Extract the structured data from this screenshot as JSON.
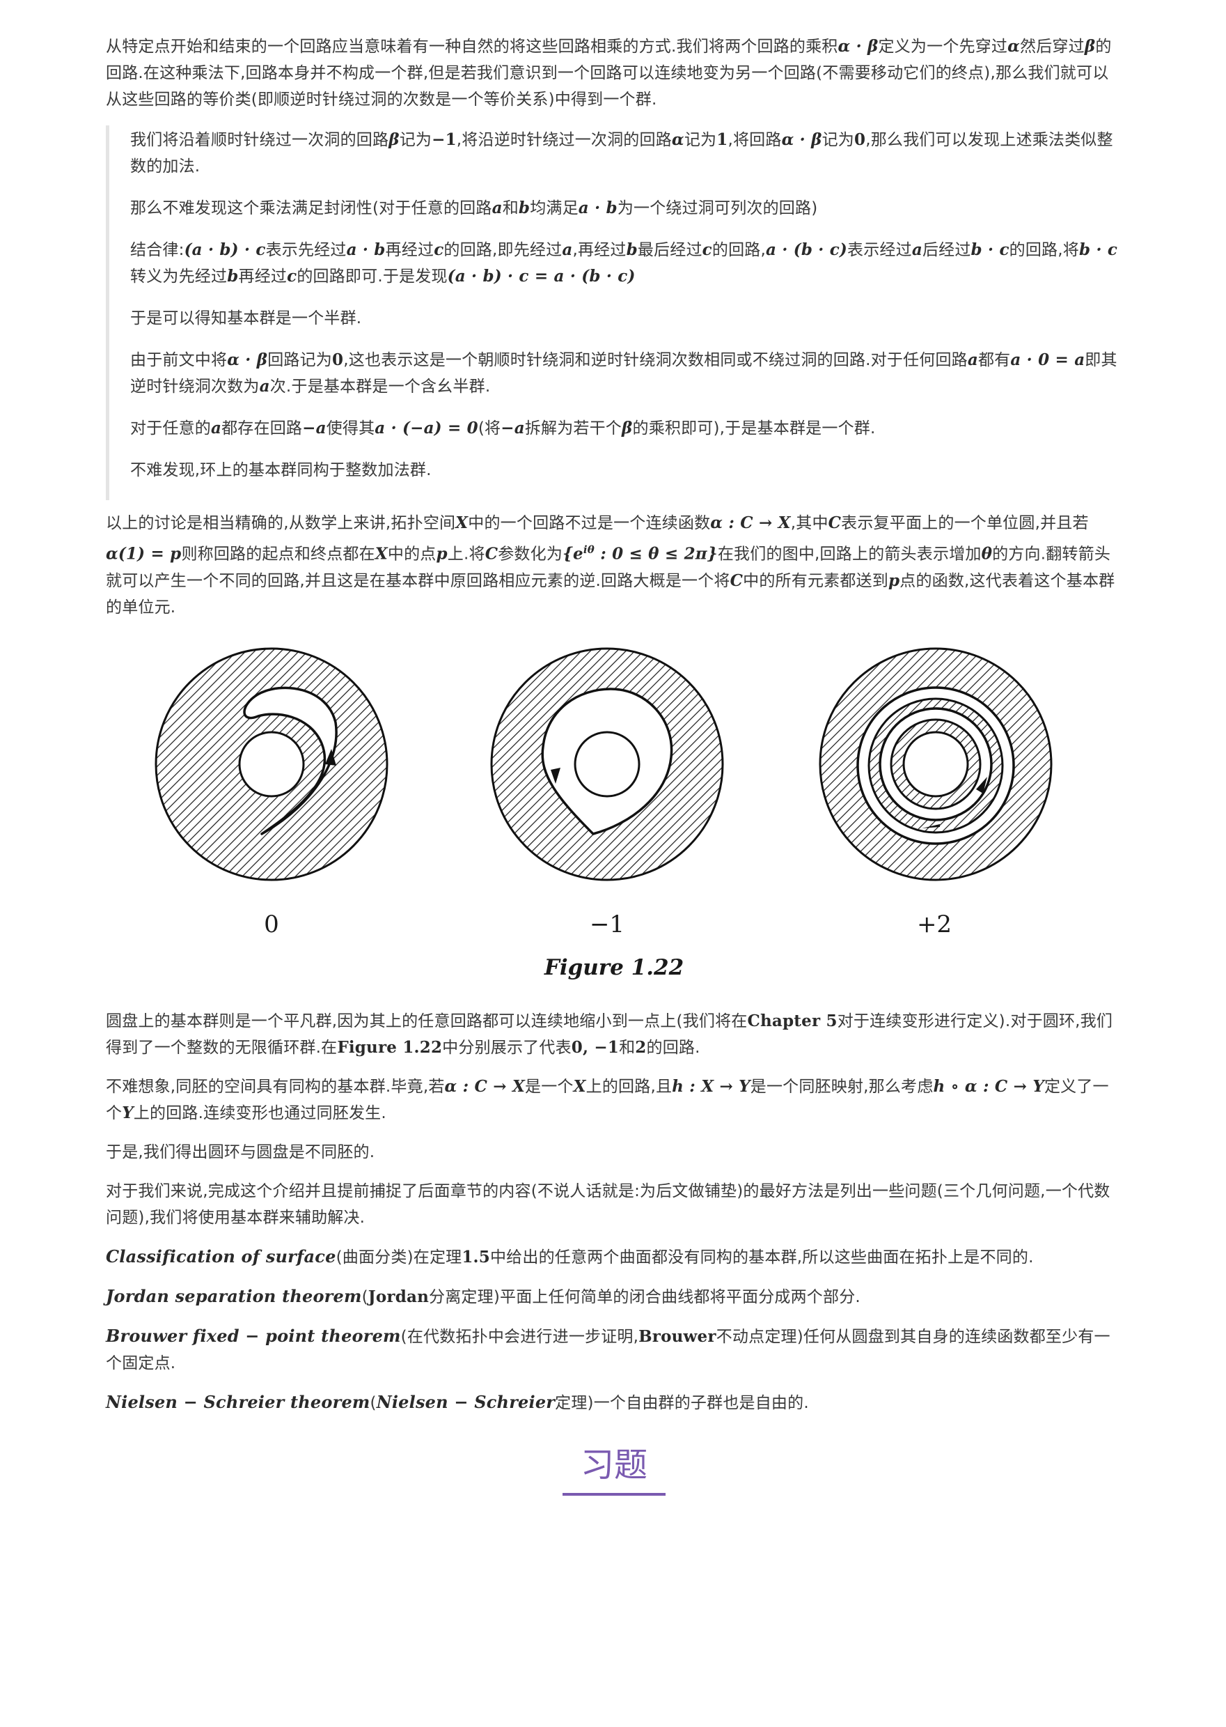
{
  "p1": [
    "从特定点开始和结束的一个回路应当意味着有一种自然的将这些回路相乘的方式.我们将两个回路的乘积",
    "α · β",
    "定义为一个先穿过",
    "α",
    "然后穿过",
    "β",
    "的回路.在这种乘法下,回路本身并不构成一个群,但是若我们意识到一个回路可以连续地变为另一个回路(不需要移动它们的终点),那么我们就可以从这些回路的等价类(即顺逆时针绕过洞的次数是一个等价关系)中得到一个群."
  ],
  "q1": [
    "我们将沿着顺时针绕过一次洞的回路",
    "β",
    "记为",
    "−1",
    ",将沿逆时针绕过一次洞的回路",
    "α",
    "记为",
    "1",
    ",将回路",
    "α · β",
    "记为",
    "0",
    ",那么我们可以发现上述乘法类似整数的加法."
  ],
  "q2": [
    "那么不难发现这个乘法满足封闭性(对于任意的回路",
    "a",
    "和",
    "b",
    "均满足",
    "a · b",
    "为一个绕过洞可列次的回路)"
  ],
  "q3": [
    "结合律:",
    "(a · b) · c",
    "表示先经过",
    "a · b",
    "再经过",
    "c",
    "的回路,即先经过",
    "a",
    ",再经过",
    "b",
    "最后经过",
    "c",
    "的回路,",
    "a · (b · c)",
    "表示经过",
    "a",
    "后经过",
    "b · c",
    "的回路,将",
    "b · c",
    "转义为先经过",
    "b",
    "再经过",
    "c",
    "的回路即可.于是发现",
    "(a · b) · c = a · (b · c)"
  ],
  "q4": "于是可以得知基本群是一个半群.",
  "q5": [
    "由于前文中将",
    "α · β",
    "回路记为",
    "0",
    ",这也表示这是一个朝顺时针绕洞和逆时针绕洞次数相同或不绕过洞的回路.对于任何回路",
    "a",
    "都有",
    "a · 0 = a",
    "即其逆时针绕洞次数为",
    "a",
    "次.于是基本群是一个含幺半群."
  ],
  "q6": [
    "对于任意的",
    "a",
    "都存在回路",
    "−a",
    "使得其",
    "a · (−a) = 0",
    "(将",
    "−a",
    "拆解为若干个",
    "β",
    "的乘积即可),于是基本群是一个群."
  ],
  "q7": "不难发现,环上的基本群同构于整数加法群.",
  "p2": [
    "以上的讨论是相当精确的,从数学上来讲,拓扑空间",
    "X",
    "中的一个回路不过是一个连续函数",
    "α : C → X",
    ",其中",
    "C",
    "表示复平面上的一个单位圆,并且若",
    "α(1) = p",
    "则称回路的起点和终点都在",
    "X",
    "中的点",
    "p",
    "上.将",
    "C",
    "参数化为",
    "{e",
    "iθ",
    " : 0 ≤ θ ≤ 2π}",
    "在我们的图中,回路上的箭头表示增加",
    "θ",
    "的方向.翻转箭头就可以产生一个不同的回路,并且这是在基本群中原回路相应元素的逆.回路大概是一个将",
    "C",
    "中的所有元素都送到",
    "p",
    "点的函数,这代表着这个基本群的单位元."
  ],
  "figure": {
    "labels": [
      "0",
      "−1",
      "+2"
    ],
    "caption": "Figure 1.22"
  },
  "p3": [
    "圆盘上的基本群则是一个平凡群,因为其上的任意回路都可以连续地缩小到一点上(我们将在",
    "Chapter 5",
    "对于连续变形进行定义).对于圆环,我们得到了一个整数的无限循环群.在",
    "Figure 1.22",
    "中分别展示了代表",
    "0, −1",
    "和",
    "2",
    "的回路."
  ],
  "p4": [
    "不难想象,同胚的空间具有同构的基本群.毕竟,若",
    "α : C → X",
    "是一个",
    "X",
    "上的回路,且",
    "h : X → Y",
    "是一个同胚映射,那么考虑",
    "h ∘ α : C → Y",
    "定义了一个",
    "Y",
    "上的回路.连续变形也通过同胚发生."
  ],
  "p5": "于是,我们得出圆环与圆盘是不同胚的.",
  "p6": "对于我们来说,完成这个介绍并且提前捕捉了后面章节的内容(不说人话就是:为后文做铺垫)的最好方法是列出一些问题(三个几何问题,一个代数问题),我们将使用基本群来辅助解决.",
  "t1": [
    "Classification of surface",
    "(曲面分类)在定理",
    "1.5",
    "中给出的任意两个曲面都没有同构的基本群,所以这些曲面在拓扑上是不同的."
  ],
  "t2": [
    "Jordan separation theorem",
    "(",
    "Jordan",
    "分离定理)平面上任何简单的闭合曲线都将平面分成两个部分."
  ],
  "t3": [
    "Brouwer fixed − point theorem",
    "(在代数拓扑中会进行进一步证明,",
    "Brouwer",
    "不动点定理)任何从圆盘到其自身的连续函数都至少有一个固定点."
  ],
  "t4": [
    "Nielsen − Schreier theorem",
    "(",
    "Nielsen − Schreier",
    "定理)一个自由群的子群也是自由的."
  ],
  "section_title": "习题",
  "colors": {
    "accent": "#7a5ab0",
    "text": "#3a3a3a"
  }
}
